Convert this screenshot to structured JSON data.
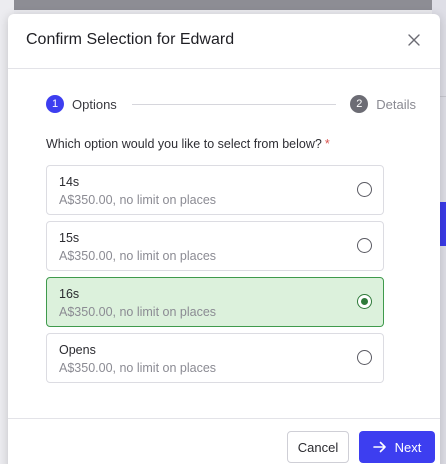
{
  "modal": {
    "title": "Confirm Selection for Edward",
    "close_icon": "close-icon"
  },
  "stepper": {
    "steps": [
      {
        "number": "1",
        "label": "Options",
        "active": true
      },
      {
        "number": "2",
        "label": "Details",
        "active": false
      }
    ]
  },
  "question": {
    "text": "Which option would you like to select from below?",
    "required_marker": "*"
  },
  "options": [
    {
      "name": "14s",
      "description": "A$350.00, no limit on places",
      "selected": false
    },
    {
      "name": "15s",
      "description": "A$350.00, no limit on places",
      "selected": false
    },
    {
      "name": "16s",
      "description": "A$350.00, no limit on places",
      "selected": true
    },
    {
      "name": "Opens",
      "description": "A$350.00, no limit on places",
      "selected": false
    }
  ],
  "footer": {
    "cancel_label": "Cancel",
    "next_label": "Next",
    "next_icon": "arrow-right-icon"
  },
  "colors": {
    "accent": "#3d3ef0",
    "selected_bg": "#dcf1dc",
    "selected_border": "#3f9a4c",
    "required": "#d9534f"
  }
}
